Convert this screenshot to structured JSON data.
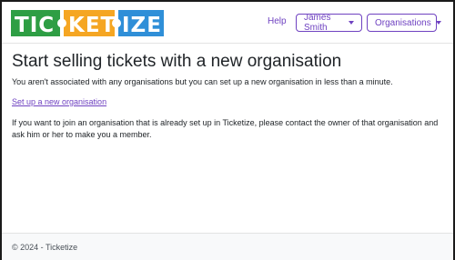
{
  "brand": {
    "letters": [
      "T",
      "I",
      "C",
      "K",
      "E",
      "T",
      "I",
      "Z",
      "E"
    ],
    "colors": {
      "green": "#2e9e44",
      "orange": "#f5a623",
      "blue": "#2f8fd8"
    }
  },
  "navbar": {
    "help": "Help",
    "user_menu": "James Smith",
    "org_menu": "Organisations"
  },
  "main": {
    "title": "Start selling tickets with a new organisation",
    "intro": "You aren't associated with any organisations but you can set up a new organisation in less than a minute.",
    "setup_link": "Set up a new organisation",
    "contact": "If you want to join an organisation that is already set up in Ticketize, please contact the owner of that organisation and ask him or her to make you a member."
  },
  "footer": {
    "text": "© 2024 - Ticketize"
  },
  "theme": {
    "accent": "#6f42c1"
  }
}
